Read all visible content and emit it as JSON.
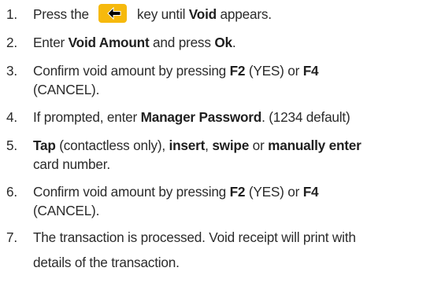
{
  "steps": [
    {
      "number": "1.",
      "lines": [
        [
          "Press the ",
          {
            "icon": "backspace-arrow-key-icon"
          },
          " key until ",
          {
            "b": "Void"
          },
          " appears."
        ]
      ]
    },
    {
      "number": "2.",
      "lines": [
        [
          "Enter ",
          {
            "b": "Void Amount"
          },
          " and press ",
          {
            "b": "Ok"
          },
          "."
        ]
      ]
    },
    {
      "number": "3.",
      "lines": [
        [
          "Confirm void amount by pressing ",
          {
            "b": "F2"
          },
          " (YES) or ",
          {
            "b": "F4"
          }
        ],
        [
          "(CANCEL)."
        ]
      ]
    },
    {
      "number": "4.",
      "lines": [
        [
          "If prompted, enter ",
          {
            "b": "Manager Password"
          },
          ". (1234 default)"
        ]
      ]
    },
    {
      "number": "5.",
      "lines": [
        [
          {
            "b": "Tap"
          },
          " (contactless only), ",
          {
            "b": "insert"
          },
          ", ",
          {
            "b": "swipe"
          },
          " or ",
          {
            "b": "manually enter"
          }
        ],
        [
          "card number."
        ]
      ]
    },
    {
      "number": "6.",
      "lines": [
        [
          "Confirm void amount by pressing ",
          {
            "b": "F2"
          },
          " (YES) or ",
          {
            "b": "F4"
          }
        ],
        [
          "(CANCEL)."
        ]
      ]
    },
    {
      "number": "7.",
      "lines": [
        [
          "The transaction is processed. Void receipt will print with"
        ],
        [
          "details of the transaction."
        ]
      ]
    }
  ],
  "colors": {
    "text": "#2b2b2b",
    "key_background": "#f6b90d",
    "key_arrow": "#000000",
    "key_stroke": "#ffffff"
  }
}
